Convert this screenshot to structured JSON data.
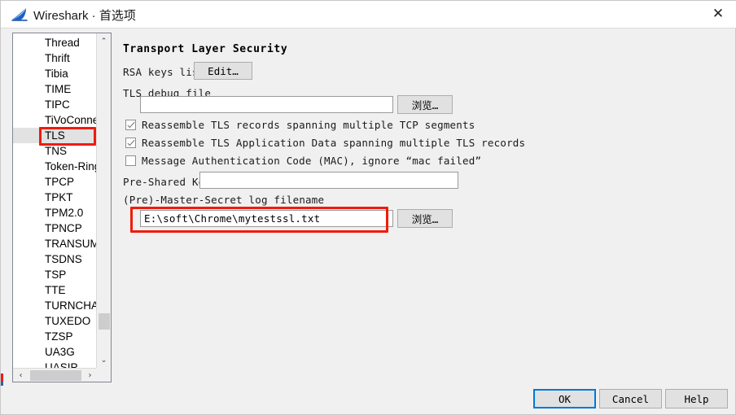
{
  "window": {
    "title": "Wireshark · 首选项",
    "icon": "wireshark-fin-icon",
    "close_label": "✕"
  },
  "sidebar": {
    "items": [
      {
        "label": "Thread",
        "selected": false
      },
      {
        "label": "Thrift",
        "selected": false
      },
      {
        "label": "Tibia",
        "selected": false
      },
      {
        "label": "TIME",
        "selected": false
      },
      {
        "label": "TIPC",
        "selected": false
      },
      {
        "label": "TiVoConnect",
        "selected": false
      },
      {
        "label": "TLS",
        "selected": true
      },
      {
        "label": "TNS",
        "selected": false
      },
      {
        "label": "Token-Ring",
        "selected": false
      },
      {
        "label": "TPCP",
        "selected": false
      },
      {
        "label": "TPKT",
        "selected": false
      },
      {
        "label": "TPM2.0",
        "selected": false
      },
      {
        "label": "TPNCP",
        "selected": false
      },
      {
        "label": "TRANSUM",
        "selected": false
      },
      {
        "label": "TSDNS",
        "selected": false
      },
      {
        "label": "TSP",
        "selected": false
      },
      {
        "label": "TTE",
        "selected": false
      },
      {
        "label": "TURNCHANNEL",
        "selected": false
      },
      {
        "label": "TUXEDO",
        "selected": false
      },
      {
        "label": "TZSP",
        "selected": false
      },
      {
        "label": "UA3G",
        "selected": false
      },
      {
        "label": "UASIP",
        "selected": false
      }
    ],
    "scroll_up_glyph": "⌃",
    "scroll_down_glyph": "⌄",
    "scroll_left_glyph": "‹",
    "scroll_right_glyph": "›"
  },
  "panel": {
    "section_title": "Transport Layer Security",
    "rsa_keys_label": "RSA keys list",
    "rsa_keys_edit_button": "Edit…",
    "tls_debug_label": "TLS debug file",
    "tls_debug_value": "",
    "tls_debug_browse_button": "浏览…",
    "checkbox_reassemble_tcp": {
      "label": "Reassemble TLS records spanning multiple TCP segments",
      "checked": true
    },
    "checkbox_reassemble_appdata": {
      "label": "Reassemble TLS Application Data spanning multiple TLS records",
      "checked": true
    },
    "checkbox_mac_ignore": {
      "label": "Message Authentication Code (MAC), ignore “mac failed”",
      "checked": false
    },
    "psk_label": "Pre-Shared Key",
    "psk_value": "",
    "master_secret_label": "(Pre)-Master-Secret log filename",
    "master_secret_value": "E:\\soft\\Chrome\\mytestssl.txt",
    "master_secret_browse_button": "浏览…"
  },
  "footer": {
    "ok_label": "OK",
    "cancel_label": "Cancel",
    "help_label": "Help"
  },
  "colors": {
    "annotation_red": "#f01b0c",
    "focus_blue": "#0078d7",
    "selection_gray": "#e2e2e2",
    "dialog_bg": "#f0f0f0"
  }
}
